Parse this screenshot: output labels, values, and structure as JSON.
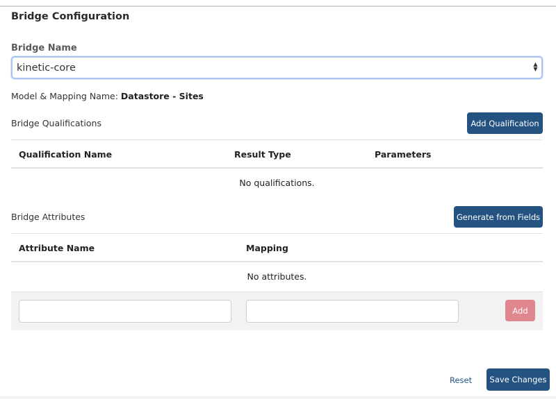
{
  "page": {
    "title": "Bridge Configuration"
  },
  "bridge_name": {
    "label": "Bridge Name",
    "selected_value": "kinetic-core"
  },
  "model_mapping": {
    "label": "Model & Mapping Name:",
    "value": "Datastore - Sites"
  },
  "qualifications": {
    "title": "Bridge Qualifications",
    "add_button": "Add Qualification",
    "columns": [
      "Qualification Name",
      "Result Type",
      "Parameters"
    ],
    "empty_text": "No qualifications."
  },
  "attributes": {
    "title": "Bridge Attributes",
    "generate_button": "Generate from Fields",
    "columns": [
      "Attribute Name",
      "Mapping"
    ],
    "empty_text": "No attributes.",
    "name_input_value": "",
    "mapping_input_value": "",
    "add_button": "Add"
  },
  "footer": {
    "reset_label": "Reset",
    "save_label": "Save Changes"
  },
  "colors": {
    "primary": "#245381",
    "add_disabled": "#e0868f",
    "focus_border": "#a9c4f0"
  }
}
